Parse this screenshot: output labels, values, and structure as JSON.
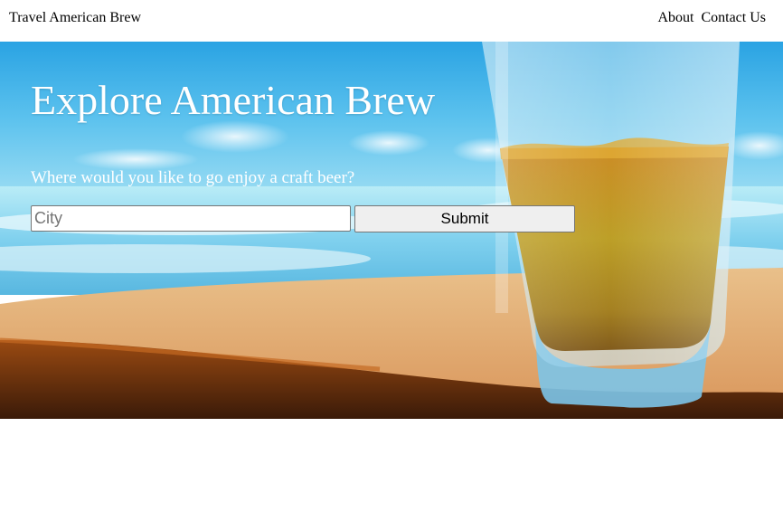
{
  "header": {
    "brand": "Travel American Brew",
    "nav": [
      "About",
      "Contact Us"
    ]
  },
  "hero": {
    "title": "Explore American Brew",
    "subtitle": "Where would you like to go enjoy a craft beer?",
    "search": {
      "placeholder": "City",
      "value": ""
    },
    "submit_label": "Submit",
    "image": "beer glass on a beach"
  },
  "colors": {
    "sky": "#3fb3e8",
    "sand": "#e6b27a",
    "beer": "#d49a1a",
    "text_on_hero": "#ffffff"
  }
}
